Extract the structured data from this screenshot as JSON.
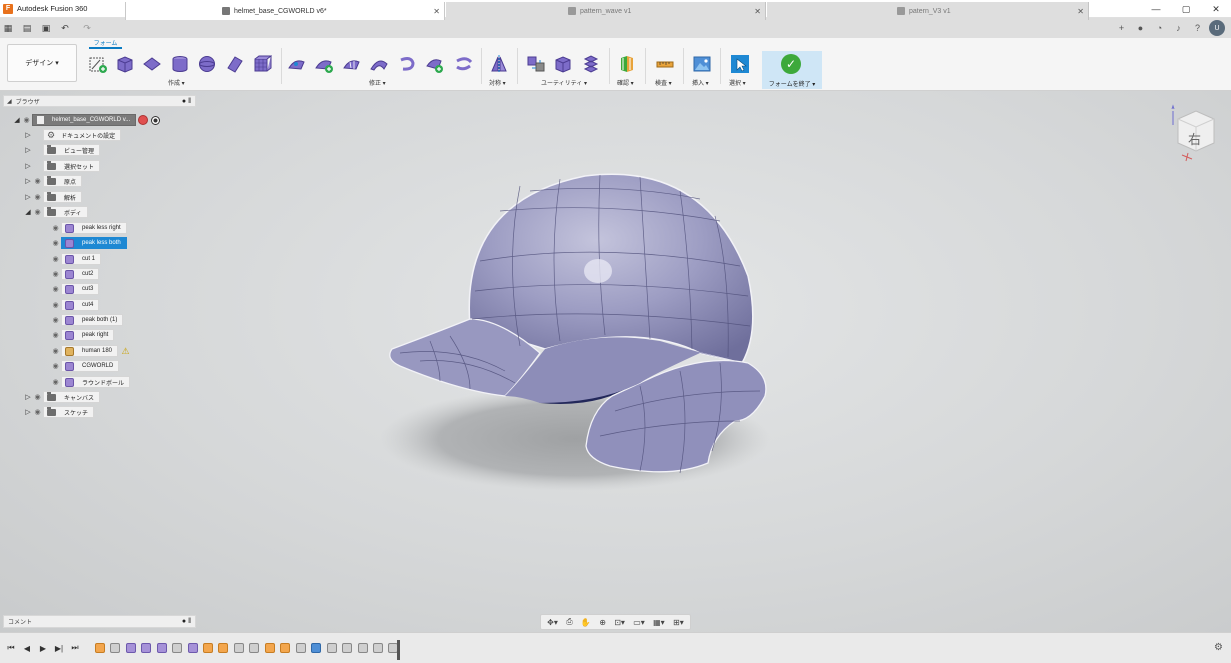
{
  "app": {
    "title": "Autodesk Fusion 360",
    "logo": "F"
  },
  "window_controls": {
    "minimize": "—",
    "maximize": "▢",
    "close": "✕"
  },
  "quick_access": {
    "grid": "▦",
    "file": "▤",
    "save": "▣",
    "undo": "↶",
    "redo": "↷"
  },
  "tabs": [
    {
      "label": "helmet_base_CGWORLD v6*",
      "close": "✕"
    },
    {
      "label": "pattern_wave v1",
      "close": "✕"
    },
    {
      "label": "patern_V3 v1",
      "close": "✕"
    }
  ],
  "tab_extras": {
    "new_tab": "+",
    "online": "●",
    "jobs": "◔",
    "notifications": "♪",
    "help": "?",
    "avatar": "U"
  },
  "toolbar": {
    "workspace": "デザイン ▾",
    "active_tab": "フォーム",
    "groups": {
      "create": "作成 ▾",
      "modify": "修正 ▾",
      "symmetry": "対称 ▾",
      "utilities": "ユーティリティ ▾",
      "inspect_color": "確認 ▾",
      "inspect": "検査 ▾",
      "insert": "挿入 ▾",
      "select": "選択 ▾",
      "finish": "フォームを終了 ▾"
    }
  },
  "browser": {
    "title": "ブラウザ",
    "collapse": "● ‖",
    "root": "helmet_base_CGWORLD v...",
    "items": [
      {
        "label": "ドキュメントの設定"
      },
      {
        "label": "ビュー管理"
      },
      {
        "label": "選択セット"
      },
      {
        "label": "原点"
      },
      {
        "label": "解析"
      },
      {
        "label": "ボディ"
      },
      {
        "label": "キャンバス"
      },
      {
        "label": "スケッチ"
      }
    ],
    "bodies": [
      {
        "label": "peak less right"
      },
      {
        "label": "peak less both"
      },
      {
        "label": "cut 1"
      },
      {
        "label": "cut2"
      },
      {
        "label": "cut3"
      },
      {
        "label": "cut4"
      },
      {
        "label": "peak both  (1)"
      },
      {
        "label": "peak right"
      },
      {
        "label": "human 180"
      },
      {
        "label": "CGWORLD"
      },
      {
        "label": "ラウンドボール"
      }
    ]
  },
  "comments": {
    "label": "コメント",
    "ctrl": "● ‖"
  },
  "viewcube": {
    "face": "右"
  },
  "navbar": {
    "orbit": "✥▾",
    "look": "⎙",
    "pan": "✋",
    "zoom": "⊕",
    "fit": "⊡▾",
    "display": "▭▾",
    "grid": "▦▾",
    "viewports": "⊞▾"
  },
  "timeline": {
    "first": "⏮",
    "prev": "◀",
    "play": "▶",
    "next": "▶|",
    "last": "⏭",
    "settings": "⚙"
  },
  "colors": {
    "accent": "#0a7bc2",
    "selection": "#1e88d3",
    "finish_ok": "#3da93b",
    "helmet": "#9f9fc4"
  }
}
